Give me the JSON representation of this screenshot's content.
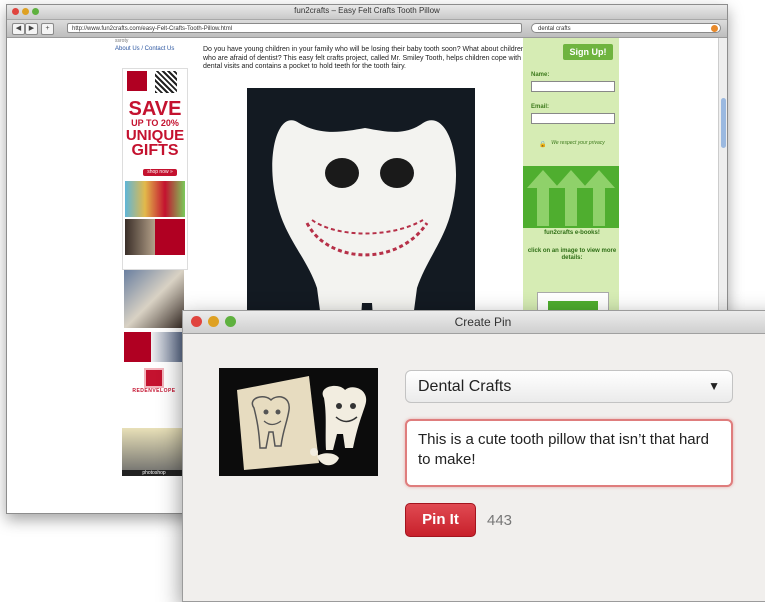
{
  "browser": {
    "title": "fun2crafts – Easy Felt Crafts Tooth Pillow",
    "url": "http://www.fun2crafts.com/easy-Felt-Crafts-Tooth-Pillow.html",
    "search_value": "dental crafts",
    "nav": {
      "back": "◀",
      "forward": "▶",
      "add": "+"
    }
  },
  "page": {
    "top_cut_text": "ssroty",
    "about_link": "About Us / Contact Us",
    "ad": {
      "save_line1": "SAVE",
      "save_line2": "UP TO 20%",
      "save_line3": "UNIQUE",
      "save_line4": "GIFTS",
      "shop_label": "shop now »",
      "brand": "REDENVELOPE"
    },
    "banner_label": "photoshop",
    "article_text": "Do you have young children in your family who will be losing their baby tooth soon? What about children who are afraid of dentist? This easy felt crafts project, called Mr. Smiley Tooth, helps children cope with dental visits and contains a pocket to hold teeth for the tooth fairy.",
    "signup_label": "Sign Up!",
    "name_label": "Name:",
    "email_label": "Email:",
    "privacy_text": "We respect your privacy",
    "ebook_title": "fun2crafts e-books!",
    "ebook_click": "click on an image to view more details:"
  },
  "dialog": {
    "title": "Create Pin",
    "board_value": "Dental Crafts",
    "dropdown_arrow": "▼",
    "description": "This is a cute tooth pillow that isn’t that hard to make!",
    "pin_button": "Pin It",
    "char_count": "443"
  }
}
